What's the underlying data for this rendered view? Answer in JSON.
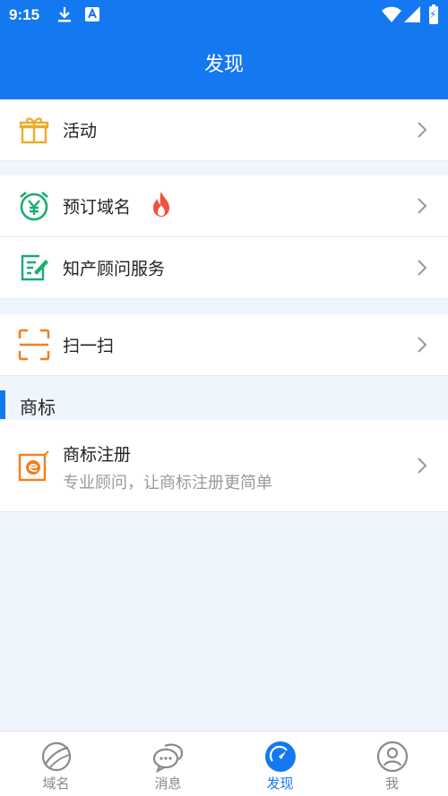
{
  "status_bar": {
    "time": "9:15",
    "battery_glyph": "⚡"
  },
  "header": {
    "title": "发现"
  },
  "menu": {
    "activities": {
      "label": "活动"
    },
    "reserve_domain": {
      "label": "预订域名",
      "icon": "alarm-yen-icon"
    },
    "ip_consulting": {
      "label": "知产顾问服务"
    },
    "scan": {
      "label": "扫一扫"
    }
  },
  "trademark_section": {
    "title": "商标",
    "item": {
      "title": "商标注册",
      "subtitle": "专业顾问，让商标注册更简单"
    }
  },
  "tabbar": {
    "tabs": [
      {
        "label": "域名",
        "icon": "planet-icon"
      },
      {
        "label": "消息",
        "icon": "chat-icon"
      },
      {
        "label": "发现",
        "icon": "compass-icon"
      },
      {
        "label": "我",
        "icon": "user-icon"
      }
    ],
    "active_index": 2
  },
  "colors": {
    "accent": "#1478f0",
    "green": "#1aac73",
    "orange": "#f57d1e",
    "fire": "#f0513a"
  }
}
